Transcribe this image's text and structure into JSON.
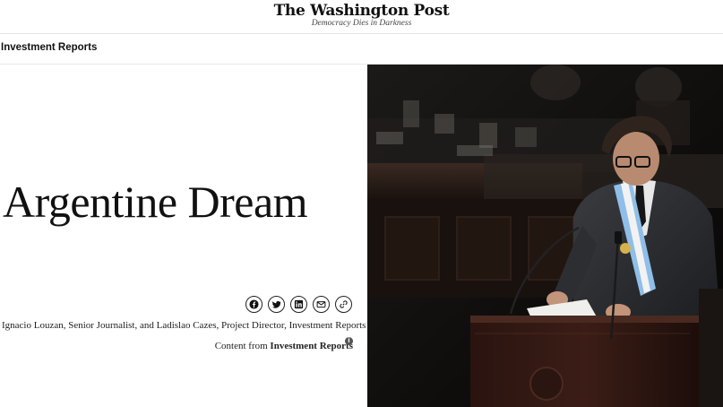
{
  "masthead": {
    "logo": "The Washington Post",
    "tagline": "Democracy Dies in Darkness"
  },
  "section": {
    "label": "Investment Reports"
  },
  "article": {
    "headline": "Argentine Dream",
    "byline": "Ignacio Louzan, Senior Journalist, and Ladislao Cazes, Project Director, Investment Reports",
    "content_from_prefix": "Content from",
    "content_from_source": "Investment Reports"
  },
  "share": {
    "buttons": [
      {
        "name": "facebook-icon"
      },
      {
        "name": "twitter-icon"
      },
      {
        "name": "linkedin-icon"
      },
      {
        "name": "email-icon"
      },
      {
        "name": "link-icon"
      }
    ]
  },
  "hero_image": {
    "subject": "speaker-at-podium"
  }
}
